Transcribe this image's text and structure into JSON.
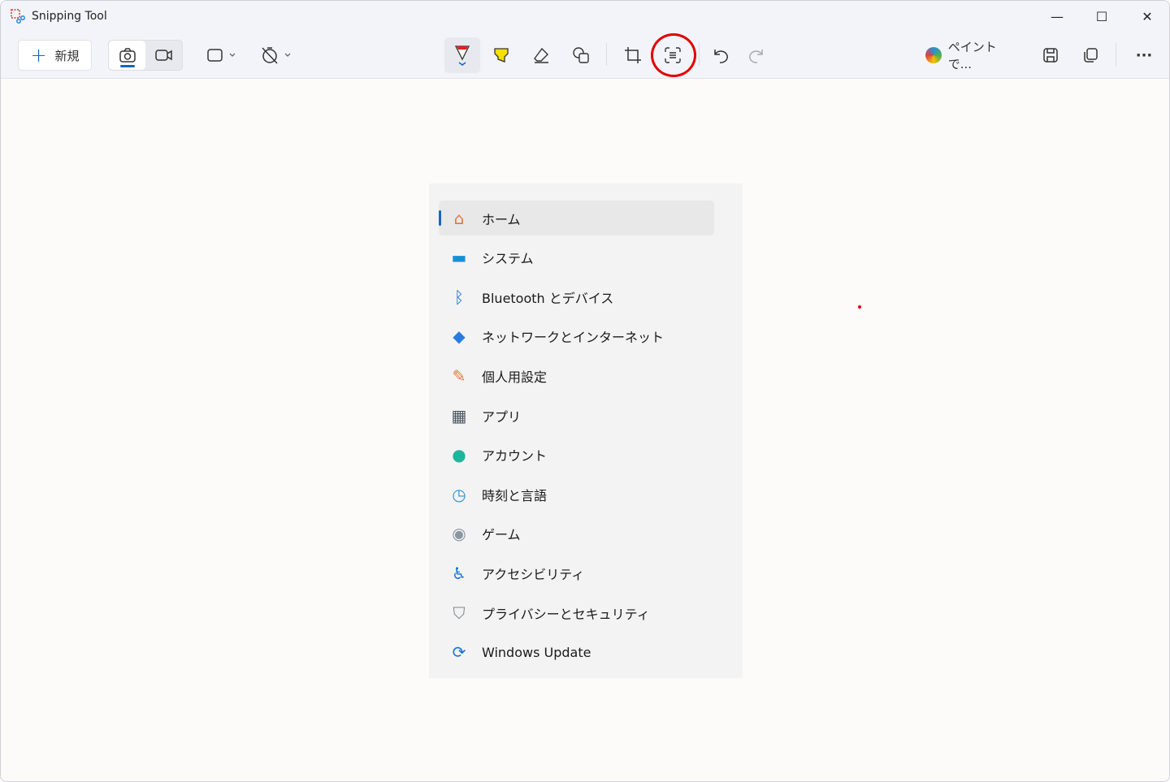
{
  "window": {
    "title": "Snipping Tool",
    "minimize": "—",
    "maximize": "☐",
    "close": "✕"
  },
  "toolbar": {
    "new_label": "新規",
    "new_icon": "+",
    "paint_label": "ペイントで...",
    "more": "···"
  },
  "settings_menu": {
    "items": [
      {
        "label": "ホーム",
        "icon": "⌂",
        "color": "#e8743b",
        "selected": true
      },
      {
        "label": "システム",
        "icon": "▬",
        "color": "#1a8fd6"
      },
      {
        "label": "Bluetooth とデバイス",
        "icon": "ᛒ",
        "color": "#1a73d6"
      },
      {
        "label": "ネットワークとインターネット",
        "icon": "◆",
        "color": "#2a7be0"
      },
      {
        "label": "個人用設定",
        "icon": "✎",
        "color": "#e8743b"
      },
      {
        "label": "アプリ",
        "icon": "▦",
        "color": "#4a5560"
      },
      {
        "label": "アカウント",
        "icon": "●",
        "color": "#1fb59a"
      },
      {
        "label": "時刻と言語",
        "icon": "◷",
        "color": "#2a8fd8"
      },
      {
        "label": "ゲーム",
        "icon": "◉",
        "color": "#8a96a0"
      },
      {
        "label": "アクセシビリティ",
        "icon": "♿",
        "color": "#1a73d6"
      },
      {
        "label": "プライバシーとセキュリティ",
        "icon": "⛉",
        "color": "#7a8490"
      },
      {
        "label": "Windows Update",
        "icon": "⟳",
        "color": "#1a73d6"
      }
    ]
  }
}
